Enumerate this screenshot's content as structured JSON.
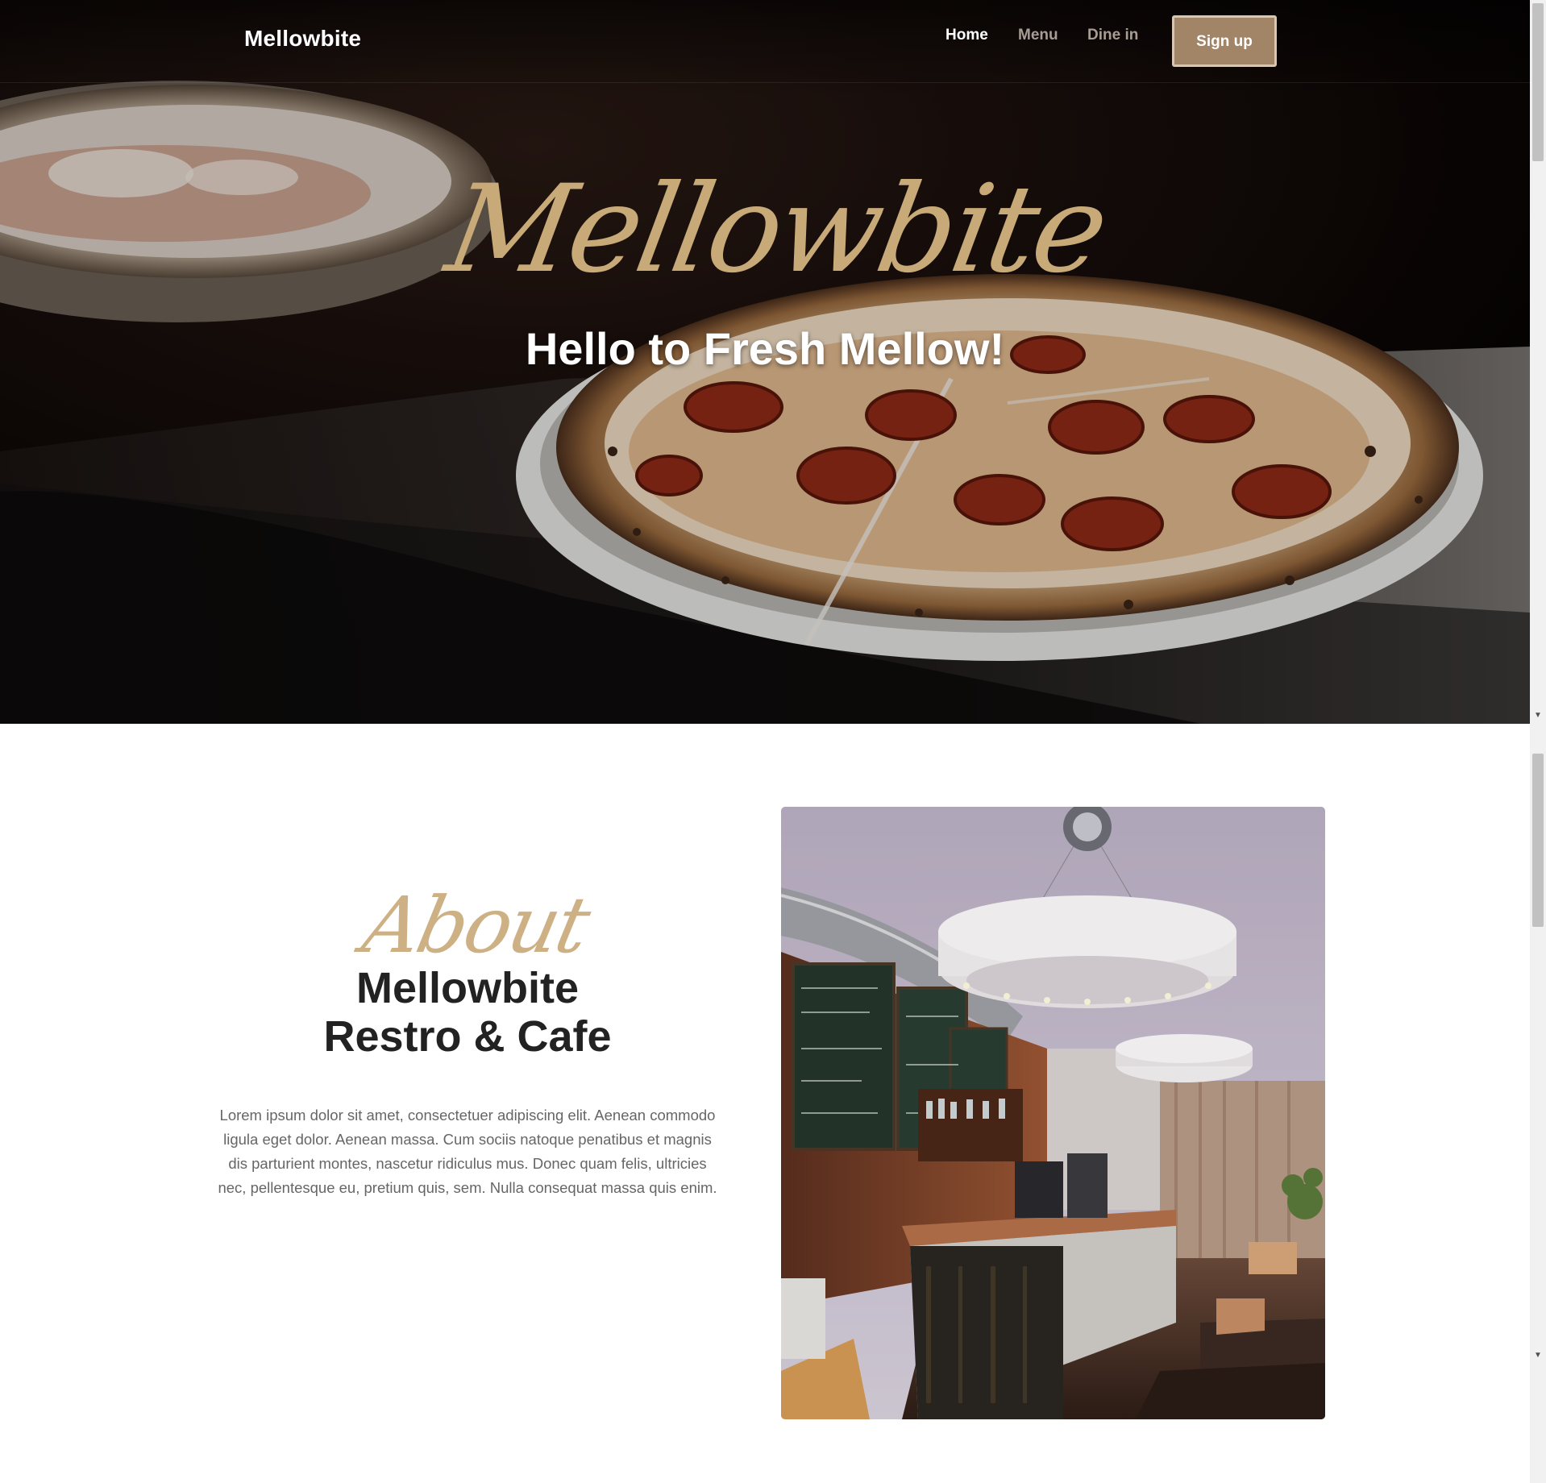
{
  "nav": {
    "brand": "Mellowbite",
    "links": [
      {
        "label": "Home",
        "active": true
      },
      {
        "label": "Menu",
        "active": false
      },
      {
        "label": "Dine in",
        "active": false
      }
    ],
    "cta": "Sign up"
  },
  "hero": {
    "script_title": "Mellowbite",
    "tagline": "Hello to Fresh Mellow!",
    "image": "pizza-photo"
  },
  "about": {
    "script_label": "About",
    "heading_line1": "Mellowbite",
    "heading_line2": "Restro & Cafe",
    "body": "Lorem ipsum dolor sit amet, consectetuer adipiscing elit. Aenean commodo ligula eget dolor. Aenean massa. Cum sociis natoque penatibus et magnis dis parturient montes, nascetur ridiculus mus. Donec quam felis, ultricies nec, pellentesque eu, pretium quis, sem. Nulla consequat massa quis enim.",
    "image": "cafe-interior-photo"
  },
  "colors": {
    "accent": "#c8a978",
    "button": "#a28467",
    "heading": "#222222",
    "body_text": "#666666"
  }
}
